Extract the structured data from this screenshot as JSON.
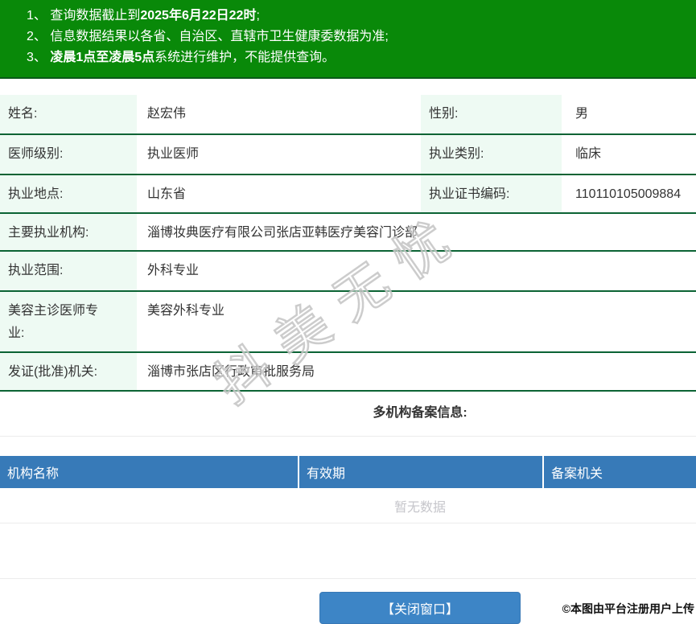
{
  "notices": [
    {
      "pre": "1、 查询数据截止到",
      "bold": "2025年6月22日22时",
      "post": ";"
    },
    {
      "pre": "2、 信息数据结果以各省、自治区、直辖市卫生健康委数据为准;",
      "bold": "",
      "post": ""
    },
    {
      "pre": "3、 ",
      "bold": "凌晨1点至凌晨5点",
      "post": "系统进行维护，不能提供查询。"
    }
  ],
  "info": {
    "name_label": "姓名:",
    "name": "赵宏伟",
    "gender_label": "性别:",
    "gender": "男",
    "level_label": "医师级别:",
    "level": "执业医师",
    "category_label": "执业类别:",
    "category": "临床",
    "location_label": "执业地点:",
    "location": "山东省",
    "cert_label": "执业证书编码:",
    "cert_no": "110110105009884",
    "org_label": "主要执业机构:",
    "org": "淄博妆典医疗有限公司张店亚韩医疗美容门诊部",
    "scope_label": "执业范围:",
    "scope": "外科专业",
    "beauty_label": "美容主诊医师专业:",
    "beauty": "美容外科专业",
    "issuer_label": "发证(批准)机关:",
    "issuer": "淄博市张店区行政审批服务局"
  },
  "multi_org": {
    "title": "多机构备案信息:",
    "columns": [
      "机构名称",
      "有效期",
      "备案机关"
    ],
    "empty_text": "暂无数据"
  },
  "footer": {
    "close_button": "【关闭窗口】",
    "upload_note": "©本图由平台注册用户上传"
  },
  "watermark": {
    "text": "抖美无忧"
  },
  "colors": {
    "banner_green": "#098909",
    "banner_border_green": "#0a5a1a",
    "row_separator_green": "#0b6334",
    "label_cell_mint": "#eefaf3",
    "table_header_blue": "#377ab8",
    "button_blue": "#3d85c6",
    "empty_text_gray": "#c6c6cb",
    "text_dark": "#333333"
  }
}
